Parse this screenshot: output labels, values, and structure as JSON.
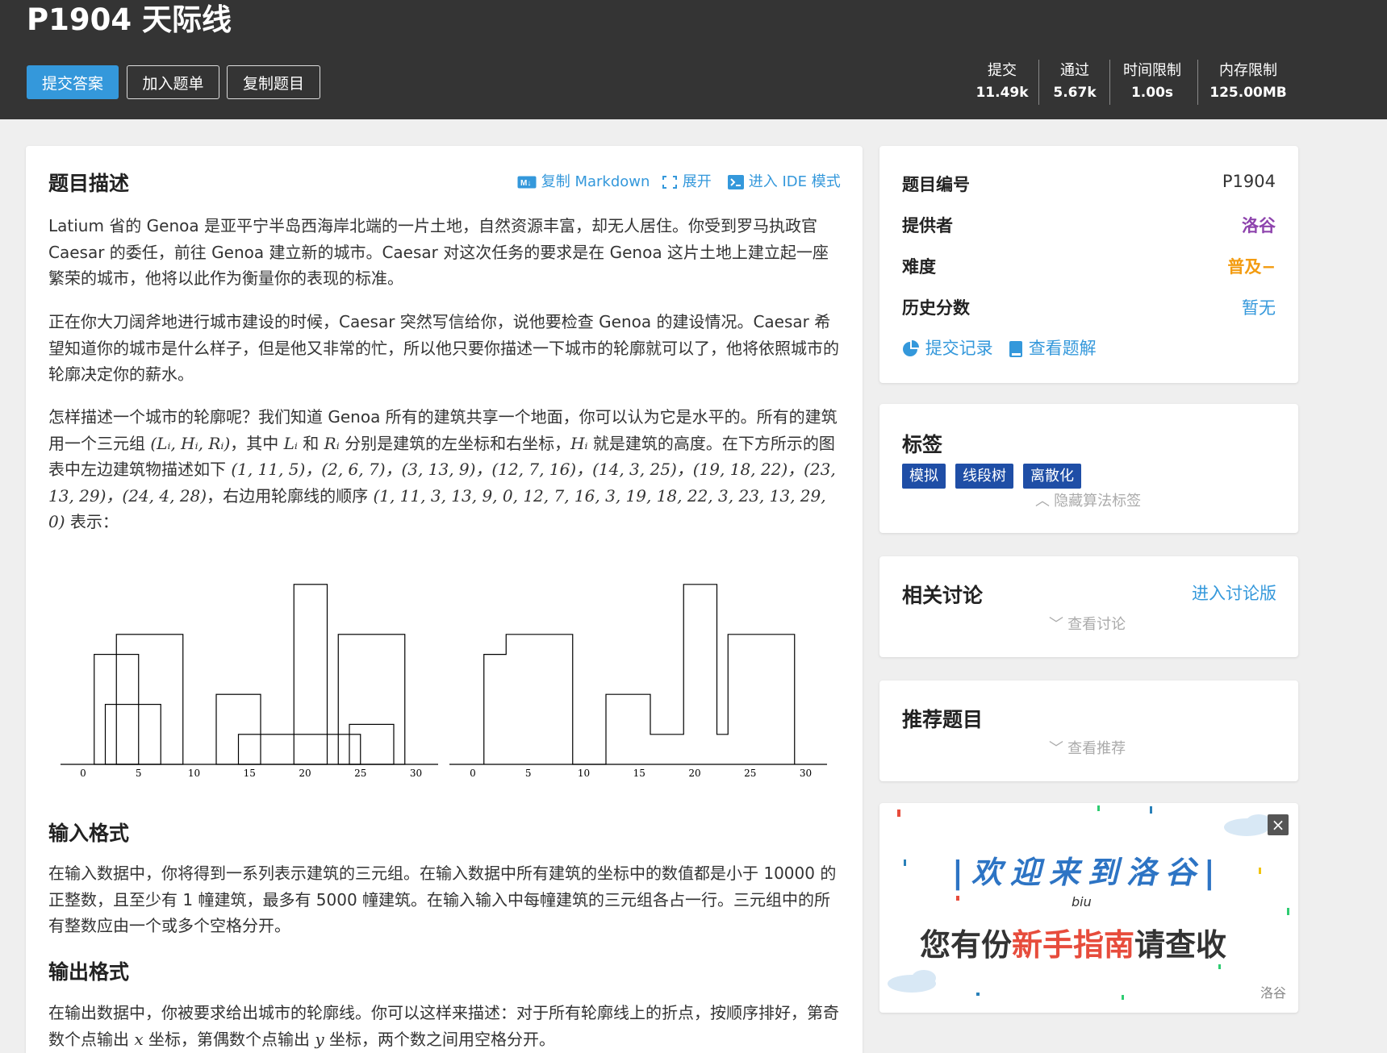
{
  "problem": {
    "title": "P1904 天际线"
  },
  "header_buttons": {
    "submit": "提交答案",
    "add_list": "加入题单",
    "copy": "复制题目"
  },
  "stats": [
    {
      "label": "提交",
      "value": "11.49k"
    },
    {
      "label": "通过",
      "value": "5.67k"
    },
    {
      "label": "时间限制",
      "value": "1.00s"
    },
    {
      "label": "内存限制",
      "value": "125.00MB"
    }
  ],
  "description": {
    "heading": "题目描述",
    "toolbar": {
      "copy_md": "复制 Markdown",
      "expand": "展开",
      "ide": "进入 IDE 模式"
    },
    "p1": "Latium 省的 Genoa 是亚平宁半岛西海岸北端的一片土地，自然资源丰富，却无人居住。你受到罗马执政官 Caesar 的委任，前往 Genoa 建立新的城市。Caesar 对这次任务的要求是在 Genoa 这片土地上建立起一座繁荣的城市，他将以此作为衡量你的表现的标准。",
    "p2": "正在你大刀阔斧地进行城市建设的时候，Caesar 突然写信给你，说他要检查 Genoa 的建设情况。Caesar 希望知道你的城市是什么样子，但是他又非常的忙，所以他只要你描述一下城市的轮廓就可以了，他将依照城市的轮廓决定你的薪水。",
    "p3": {
      "t1": "怎样描述一个城市的轮廓呢？我们知道 Genoa 所有的建筑共享一个地面，你可以认为它是水平的。所有的建筑用一个三元组 ",
      "m1": "(Lᵢ, Hᵢ, Rᵢ)",
      "t2": "，其中 ",
      "m2": "Lᵢ",
      "t3": " 和 ",
      "m3": "Rᵢ",
      "t4": " 分别是建筑的左坐标和右坐标，",
      "m4": "Hᵢ",
      "t5": " 就是建筑的高度。在下方所示的图表中左边建筑物描述如下 ",
      "m5": "(1, 11, 5)，(2, 6, 7)，(3, 13, 9)，(12, 7, 16)，(14, 3, 25)，(19, 18, 22)，(23, 13, 29)，(24, 4, 28)",
      "t6": "，右边用轮廓线的顺序 ",
      "m6": "(1, 11, 3, 13, 9, 0, 12, 7, 16, 3, 19, 18, 22, 3, 23, 13, 29, 0)",
      "t7": " 表示："
    }
  },
  "figure": {
    "ticks": [
      "0",
      "5",
      "10",
      "15",
      "20",
      "25",
      "30"
    ],
    "buildings": [
      [
        1,
        11,
        5
      ],
      [
        2,
        6,
        7
      ],
      [
        3,
        13,
        9
      ],
      [
        12,
        7,
        16
      ],
      [
        14,
        3,
        25
      ],
      [
        19,
        18,
        22
      ],
      [
        23,
        13,
        29
      ],
      [
        24,
        4,
        28
      ]
    ],
    "skyline": [
      1,
      11,
      3,
      13,
      9,
      0,
      12,
      7,
      16,
      3,
      19,
      18,
      22,
      3,
      23,
      13,
      29,
      0
    ]
  },
  "input": {
    "heading": "输入格式",
    "text": "在输入数据中，你将得到一系列表示建筑的三元组。在输入数据中所有建筑的坐标中的数值都是小于 10000 的正整数，且至少有 1 幢建筑，最多有 5000 幢建筑。在输入输入中每幢建筑的三元组各占一行。三元组中的所有整数应由一个或多个空格分开。"
  },
  "output": {
    "heading": "输出格式",
    "t1": "在输出数据中，你被要求给出城市的轮廓线。你可以这样来描述：对于所有轮廓线上的折点，按顺序排好，第奇数个点输出 ",
    "m1": "x",
    "t2": " 坐标，第偶数个点输出 ",
    "m2": "y",
    "t3": " 坐标，两个数之间用空格分开。"
  },
  "info": {
    "rows": [
      {
        "key": "题目编号",
        "value": "P1904"
      },
      {
        "key": "提供者",
        "value": "洛谷"
      },
      {
        "key": "难度",
        "value": "普及−"
      },
      {
        "key": "历史分数",
        "value": "暂无"
      }
    ],
    "submissions": "提交记录",
    "solutions": "查看题解"
  },
  "tags": {
    "heading": "标签",
    "items": [
      "模拟",
      "线段树",
      "离散化"
    ],
    "hide": "隐藏算法标签"
  },
  "discuss": {
    "heading": "相关讨论",
    "link": "进入讨论版",
    "view": "查看讨论"
  },
  "recommend": {
    "heading": "推荐题目",
    "view": "查看推荐"
  },
  "ad": {
    "title": "欢迎来到洛谷",
    "biu": "biu",
    "p1": "您有份",
    "p2": "新手指南",
    "p3": "请查收",
    "brand": "洛谷",
    "close": "×"
  },
  "colors": {
    "header": "#343434",
    "accent": "#3498db",
    "tag": "#1f4ea6",
    "provider": "#8e44ad",
    "difficulty": "#f39c11",
    "brand_pink": "#e74c3c"
  }
}
